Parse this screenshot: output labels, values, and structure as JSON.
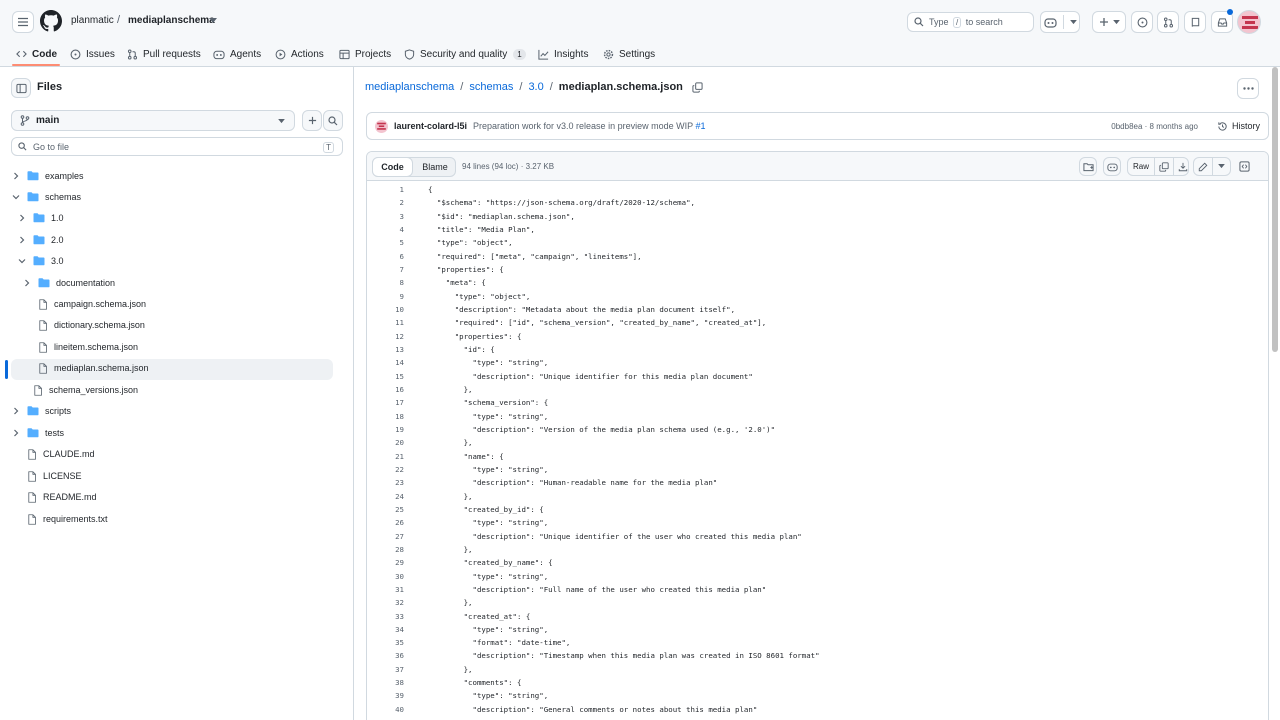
{
  "header": {
    "owner": "planmatic",
    "separator": "/",
    "repo": "mediaplanschema",
    "search": {
      "prefix": "Type",
      "key": "/",
      "suffix": "to search"
    }
  },
  "nav": {
    "tabs": [
      {
        "label": "Code",
        "icon": "code-icon"
      },
      {
        "label": "Issues",
        "icon": "issue-icon"
      },
      {
        "label": "Pull requests",
        "icon": "pull-request-icon"
      },
      {
        "label": "Agents",
        "icon": "agents-icon"
      },
      {
        "label": "Actions",
        "icon": "play-icon"
      },
      {
        "label": "Projects",
        "icon": "table-icon"
      },
      {
        "label": "Security and quality",
        "icon": "shield-icon",
        "count": "1"
      },
      {
        "label": "Insights",
        "icon": "graph-icon"
      },
      {
        "label": "Settings",
        "icon": "gear-icon"
      }
    ]
  },
  "sidebar": {
    "title": "Files",
    "branch": "main",
    "goto_placeholder": "Go to file",
    "goto_key": "T",
    "tree": [
      {
        "label": "examples",
        "type": "folder",
        "level": 0,
        "expanded": false
      },
      {
        "label": "schemas",
        "type": "folder",
        "level": 0,
        "expanded": true
      },
      {
        "label": "1.0",
        "type": "folder",
        "level": 1,
        "expanded": false
      },
      {
        "label": "2.0",
        "type": "folder",
        "level": 1,
        "expanded": false
      },
      {
        "label": "3.0",
        "type": "folder",
        "level": 1,
        "expanded": true
      },
      {
        "label": "documentation",
        "type": "folder",
        "level": 2,
        "expanded": false
      },
      {
        "label": "campaign.schema.json",
        "type": "file",
        "level": 2
      },
      {
        "label": "dictionary.schema.json",
        "type": "file",
        "level": 2
      },
      {
        "label": "lineitem.schema.json",
        "type": "file",
        "level": 2
      },
      {
        "label": "mediaplan.schema.json",
        "type": "file",
        "level": 2,
        "selected": true
      },
      {
        "label": "schema_versions.json",
        "type": "file",
        "level": 1
      },
      {
        "label": "scripts",
        "type": "folder",
        "level": 0,
        "expanded": false
      },
      {
        "label": "tests",
        "type": "folder",
        "level": 0,
        "expanded": false
      },
      {
        "label": "CLAUDE.md",
        "type": "file",
        "level": 0
      },
      {
        "label": "LICENSE",
        "type": "file",
        "level": 0
      },
      {
        "label": "README.md",
        "type": "file",
        "level": 0
      },
      {
        "label": "requirements.txt",
        "type": "file",
        "level": 0
      }
    ]
  },
  "breadcrumb": {
    "root": "mediaplanschema",
    "dir1": "schemas",
    "dir2": "3.0",
    "file": "mediaplan.schema.json",
    "sep": "/"
  },
  "commit": {
    "author": "laurent-colard-l5i",
    "message": "Preparation work for v3.0 release in preview mode WIP",
    "pr": "#1",
    "sha_time": "0bdb8ea · 8 months ago",
    "history_label": "History"
  },
  "code": {
    "tab_code": "Code",
    "tab_blame": "Blame",
    "meta": "94 lines (94 loc) · 3.27 KB",
    "raw_label": "Raw",
    "lines": [
      "{",
      "  \"$schema\": \"https://json-schema.org/draft/2020-12/schema\",",
      "  \"$id\": \"mediaplan.schema.json\",",
      "  \"title\": \"Media Plan\",",
      "  \"type\": \"object\",",
      "  \"required\": [\"meta\", \"campaign\", \"lineitems\"],",
      "  \"properties\": {",
      "    \"meta\": {",
      "      \"type\": \"object\",",
      "      \"description\": \"Metadata about the media plan document itself\",",
      "      \"required\": [\"id\", \"schema_version\", \"created_by_name\", \"created_at\"],",
      "      \"properties\": {",
      "        \"id\": {",
      "          \"type\": \"string\",",
      "          \"description\": \"Unique identifier for this media plan document\"",
      "        },",
      "        \"schema_version\": {",
      "          \"type\": \"string\",",
      "          \"description\": \"Version of the media plan schema used (e.g., '2.0')\"",
      "        },",
      "        \"name\": {",
      "          \"type\": \"string\",",
      "          \"description\": \"Human-readable name for the media plan\"",
      "        },",
      "        \"created_by_id\": {",
      "          \"type\": \"string\",",
      "          \"description\": \"Unique identifier of the user who created this media plan\"",
      "        },",
      "        \"created_by_name\": {",
      "          \"type\": \"string\",",
      "          \"description\": \"Full name of the user who created this media plan\"",
      "        },",
      "        \"created_at\": {",
      "          \"type\": \"string\",",
      "          \"format\": \"date-time\",",
      "          \"description\": \"Timestamp when this media plan was created in ISO 8601 format\"",
      "        },",
      "        \"comments\": {",
      "          \"type\": \"string\",",
      "          \"description\": \"General comments or notes about this media plan\""
    ]
  },
  "colors": {
    "accent": "#0969da",
    "tab_underline": "#fd8c73",
    "border": "#d1d9e0",
    "folder": "#54aeff"
  }
}
